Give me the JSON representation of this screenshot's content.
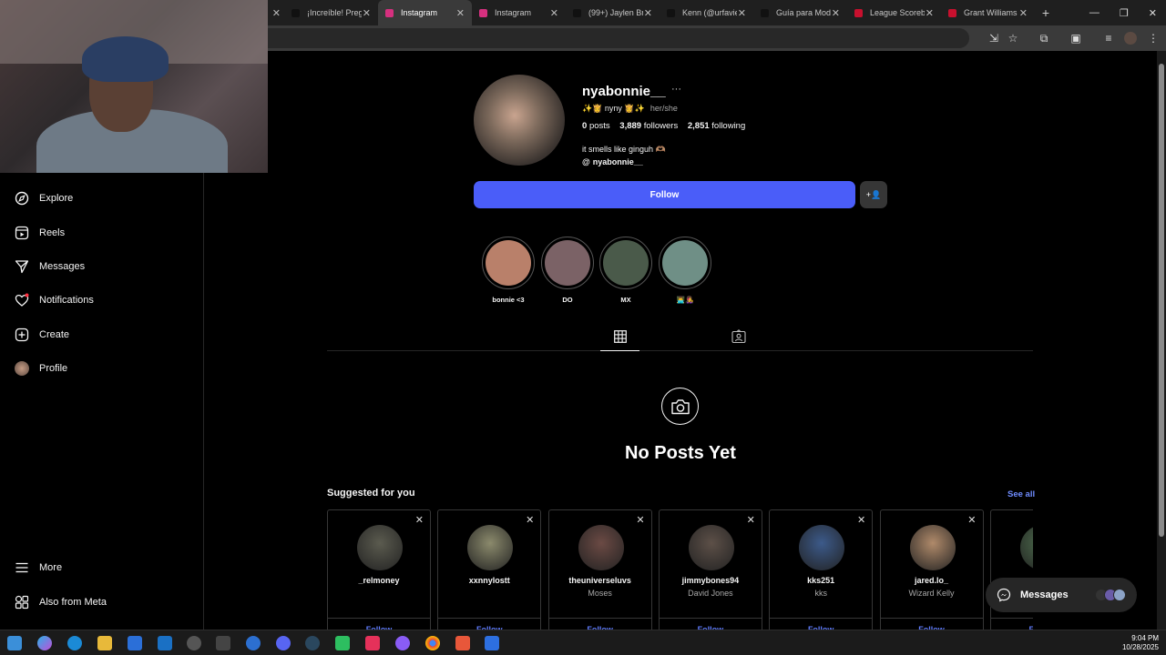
{
  "browser": {
    "tabs": [
      {
        "title": "¡Increíble! Preg",
        "favicon": "tiktok-icon",
        "active": false
      },
      {
        "title": "Instagram",
        "favicon": "instagram-icon",
        "active": true
      },
      {
        "title": "Instagram",
        "favicon": "instagram-icon",
        "active": false
      },
      {
        "title": "(99+) Jaylen Bro",
        "favicon": "tiktok-icon",
        "active": false
      },
      {
        "title": "Kenn (@urfavie",
        "favicon": "tiktok-icon",
        "active": false
      },
      {
        "title": "Guía para Mod",
        "favicon": "tiktok-icon",
        "active": false
      },
      {
        "title": "League Scoreb",
        "favicon": "espn-icon",
        "active": false
      },
      {
        "title": "Grant Williams",
        "favicon": "espn-icon",
        "active": false
      }
    ],
    "new_tab": "+"
  },
  "sidebar": {
    "items": [
      {
        "label": "Explore",
        "icon": "compass-icon"
      },
      {
        "label": "Reels",
        "icon": "reels-icon"
      },
      {
        "label": "Messages",
        "icon": "paper-plane-icon"
      },
      {
        "label": "Notifications",
        "icon": "heart-icon"
      },
      {
        "label": "Create",
        "icon": "plus-square-icon"
      },
      {
        "label": "Profile",
        "icon": "avatar-icon"
      }
    ],
    "bottom": [
      {
        "label": "More",
        "icon": "hamburger-icon"
      },
      {
        "label": "Also from Meta",
        "icon": "meta-apps-icon"
      }
    ]
  },
  "profile": {
    "username": "nyabonnie__",
    "more": "···",
    "name_line": "✨👸 nyny 👸✨",
    "pronouns": "her/she",
    "posts_count": "0",
    "posts_label": "posts",
    "followers_count": "3,889",
    "followers_label": "followers",
    "following_count": "2,851",
    "following_label": "following",
    "bio": "it smells like ginguh 🫶🏽",
    "threads_handle": "nyabonnie__",
    "follow_label": "Follow",
    "suggest_icon": "+👤"
  },
  "highlights": [
    {
      "label": "bonnie <3",
      "color": "#b9806a"
    },
    {
      "label": "DO",
      "color": "#7b6266"
    },
    {
      "label": "MX",
      "color": "#4a5a4a"
    },
    {
      "label": "👨‍💻👩‍🎤",
      "color": "#6f8f86"
    }
  ],
  "empty_state": {
    "title": "No Posts Yet"
  },
  "suggested": {
    "title": "Suggested for you",
    "see_all": "See all",
    "follow_label": "Follow",
    "cards": [
      {
        "username": "_relmoney",
        "name": "",
        "color": "#5b5b4f"
      },
      {
        "username": "xxnnylostt",
        "name": "",
        "color": "#8b8a6c"
      },
      {
        "username": "theuniverseluvs",
        "name": "Moses",
        "color": "#6b4a44"
      },
      {
        "username": "jimmybones94",
        "name": "David Jones",
        "color": "#5d5048"
      },
      {
        "username": "kks251",
        "name": "kks",
        "color": "#3c5a8a"
      },
      {
        "username": "jared.lo_",
        "name": "Wizard Kelly",
        "color": "#b08a6a"
      },
      {
        "username": "",
        "name": "",
        "color": "#4d6d4d"
      }
    ]
  },
  "messages_pill": {
    "label": "Messages"
  },
  "taskbar": {
    "time": "9:04 PM",
    "date": "10/28/2025"
  }
}
